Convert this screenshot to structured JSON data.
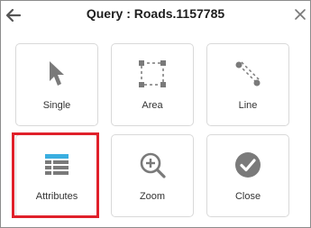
{
  "dialog": {
    "title": "Query : Roads.1157785",
    "back_icon": "arrow-left-icon",
    "close_icon": "close-icon"
  },
  "tools": [
    {
      "label": "Single",
      "icon": "cursor-pointer-icon"
    },
    {
      "label": "Area",
      "icon": "dashed-rectangle-icon"
    },
    {
      "label": "Line",
      "icon": "dashed-line-icon"
    },
    {
      "label": "Attributes",
      "icon": "table-icon",
      "highlighted": true
    },
    {
      "label": "Zoom",
      "icon": "zoom-in-icon"
    },
    {
      "label": "Close",
      "icon": "check-circle-icon"
    }
  ],
  "colors": {
    "icon_gray": "#7a7a7a",
    "table_blue": "#3aaee0",
    "highlight_red": "#e0202a",
    "tile_border": "#d9d9d9"
  }
}
